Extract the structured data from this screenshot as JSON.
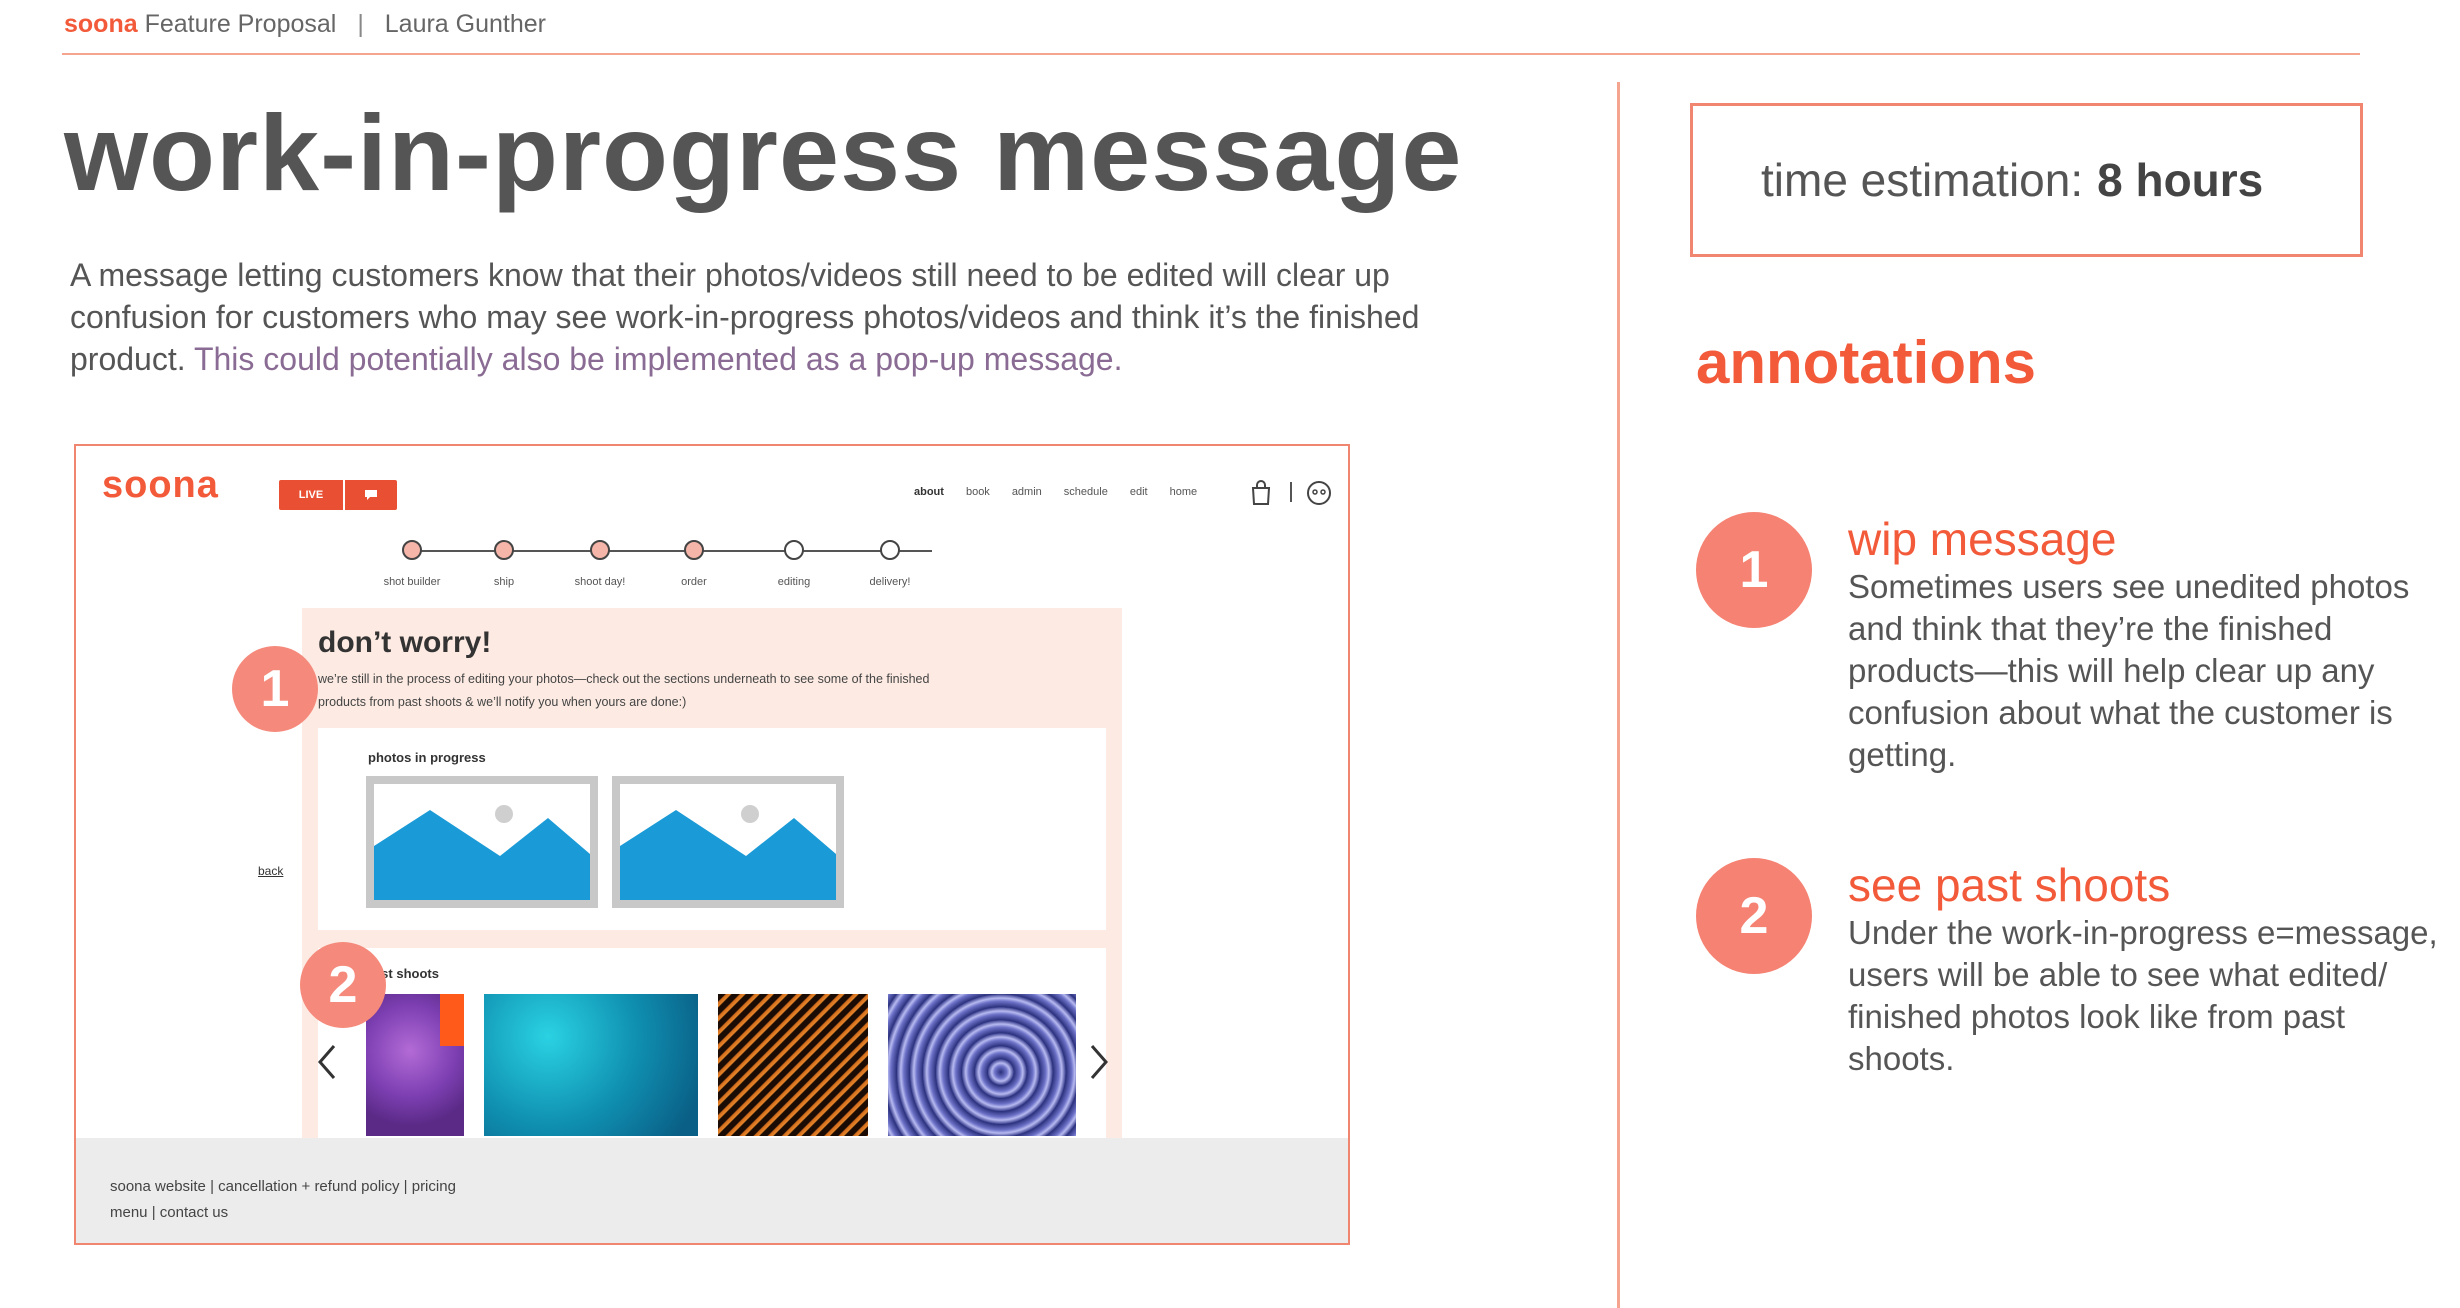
{
  "header": {
    "brand": "soona",
    "doc_title": "Feature Proposal",
    "separator": "|",
    "author": "Laura Gunther"
  },
  "page_title": "work-in-progress message",
  "intro": {
    "main": "A message letting customers know that their photos/videos still need to be edited will clear up confusion for customers who may see work-in-progress photos/videos and think it’s the finished product.",
    "highlight": " This could potentially also be implemented as a pop-up message."
  },
  "estimate": {
    "label": "time estimation:",
    "value": "8 hours"
  },
  "annotations": {
    "title": "annotations",
    "items": [
      {
        "number": "1",
        "heading": "wip message",
        "body": "Sometimes users see unedited photos and think that they’re the finished products—this will help clear up any confusion about what the customer is getting."
      },
      {
        "number": "2",
        "heading": "see past shoots",
        "body": "Under the work-in-progress e=message, users will be able to see what edited/ finished photos look like from past shoots."
      }
    ]
  },
  "mockup": {
    "logo": "soona",
    "live_label": "LIVE",
    "nav": [
      "about",
      "book",
      "admin",
      "schedule",
      "edit",
      "home"
    ],
    "steps": [
      {
        "label": "shot builder",
        "done": true
      },
      {
        "label": "ship",
        "done": true
      },
      {
        "label": "shoot day!",
        "done": true
      },
      {
        "label": "order",
        "done": true
      },
      {
        "label": "editing",
        "done": false
      },
      {
        "label": "delivery!",
        "done": false
      }
    ],
    "message_title": "don’t worry!",
    "message_text": "we’re still in the process of editing your photos—check out the sections underneath to see some of the finished products from past shoots & we’ll notify you when yours are done:)",
    "photos_title": "photos in progress",
    "past_title": "past shoots",
    "back": "back",
    "footer_line1": "soona website | cancellation + refund policy | pricing",
    "footer_line2": "menu | contact us",
    "badge1": "1",
    "badge2": "2"
  },
  "colors": {
    "accent": "#f25a3a",
    "badge": "#f58272",
    "panel": "#fdebe3",
    "mountain": "#1a9ad6"
  }
}
